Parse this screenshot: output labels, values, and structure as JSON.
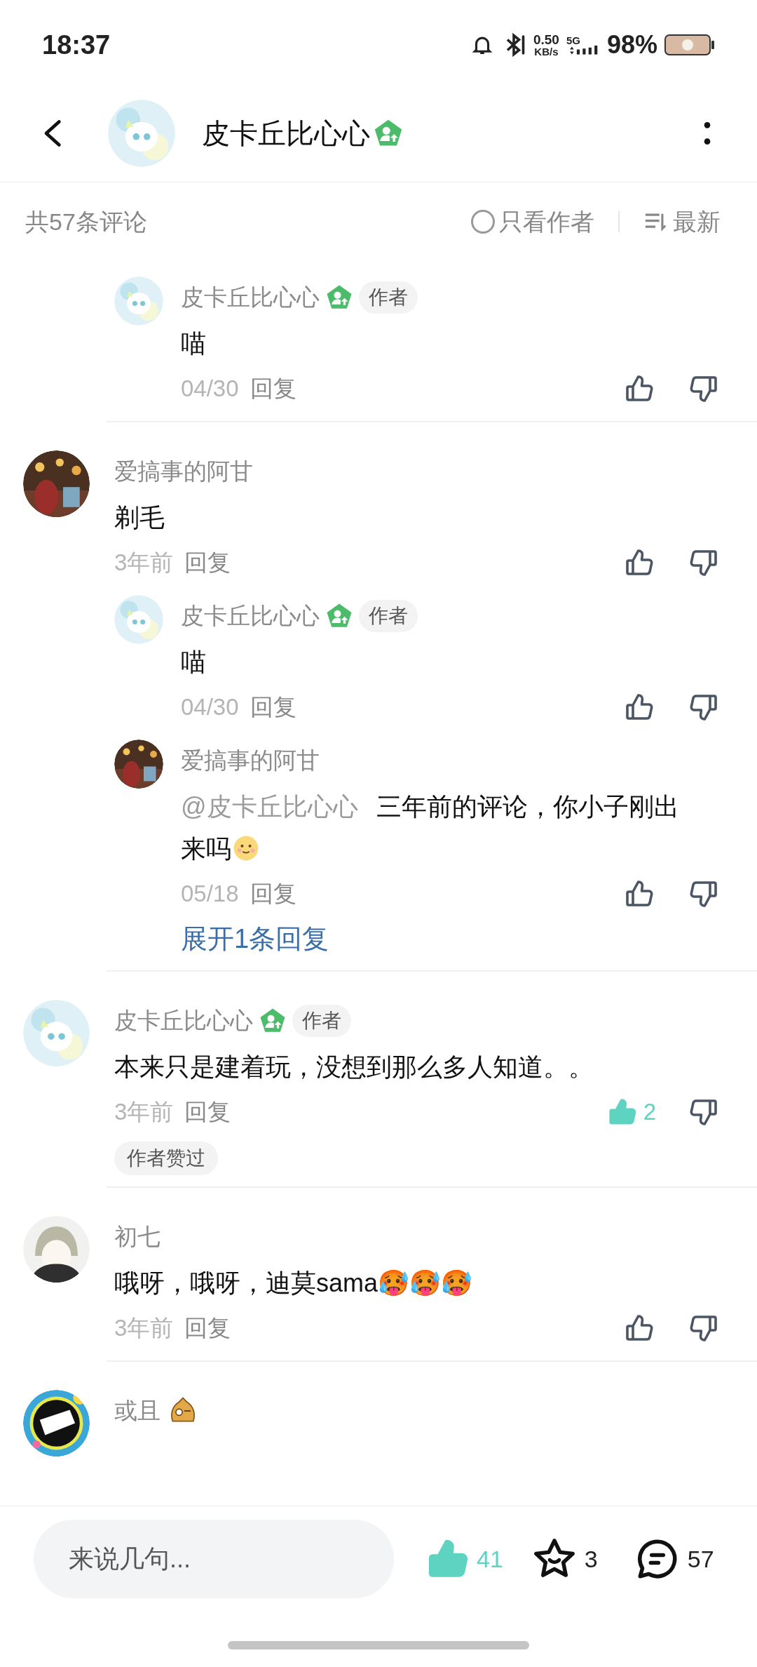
{
  "status_bar": {
    "time": "18:37",
    "net_speed": "0.50",
    "net_unit": "KB/s",
    "network": "5G",
    "battery": "98%"
  },
  "header": {
    "title": "皮卡丘比心心",
    "verified": true
  },
  "filter_bar": {
    "count": "共57条评论",
    "author_only": {
      "label": "只看作者",
      "checked": false
    },
    "sort": "最新"
  },
  "comments": [
    {
      "kind": "reply",
      "author": "皮卡丘比心心",
      "verified": true,
      "tag": "作者",
      "text": "喵",
      "time": "04/30",
      "reply": "回复",
      "liked": false
    },
    {
      "kind": "comment",
      "author": "爱搞事的阿甘",
      "text": "剃毛",
      "time": "3年前",
      "reply": "回复",
      "liked": false,
      "children": [
        {
          "kind": "reply",
          "author": "皮卡丘比心心",
          "verified": true,
          "tag": "作者",
          "text": "喵",
          "time": "04/30",
          "reply": "回复",
          "liked": false
        },
        {
          "kind": "reply",
          "author": "爱搞事的阿甘",
          "mention": "@皮卡丘比心心",
          "text": "三年前的评论，你小子刚出来吗",
          "sticker": true,
          "time": "05/18",
          "reply": "回复",
          "liked": false
        }
      ],
      "expand": "展开1条回复"
    },
    {
      "kind": "comment",
      "author": "皮卡丘比心心",
      "verified": true,
      "tag": "作者",
      "text": "本来只是建着玩，没想到那么多人知道。。",
      "time": "3年前",
      "reply": "回复",
      "liked": true,
      "like_count": "2",
      "author_liked": "作者赞过"
    },
    {
      "kind": "comment",
      "author": "初七",
      "text": "哦呀，哦呀，迪莫sama🥵🥵🥵",
      "time": "3年前",
      "reply": "回复",
      "liked": false
    },
    {
      "kind": "comment",
      "author": "或且",
      "name_sticker": true
    }
  ],
  "bottom_bar": {
    "placeholder": "来说几句...",
    "liked": true,
    "likes": "41",
    "stars": "3",
    "comments": "57"
  }
}
